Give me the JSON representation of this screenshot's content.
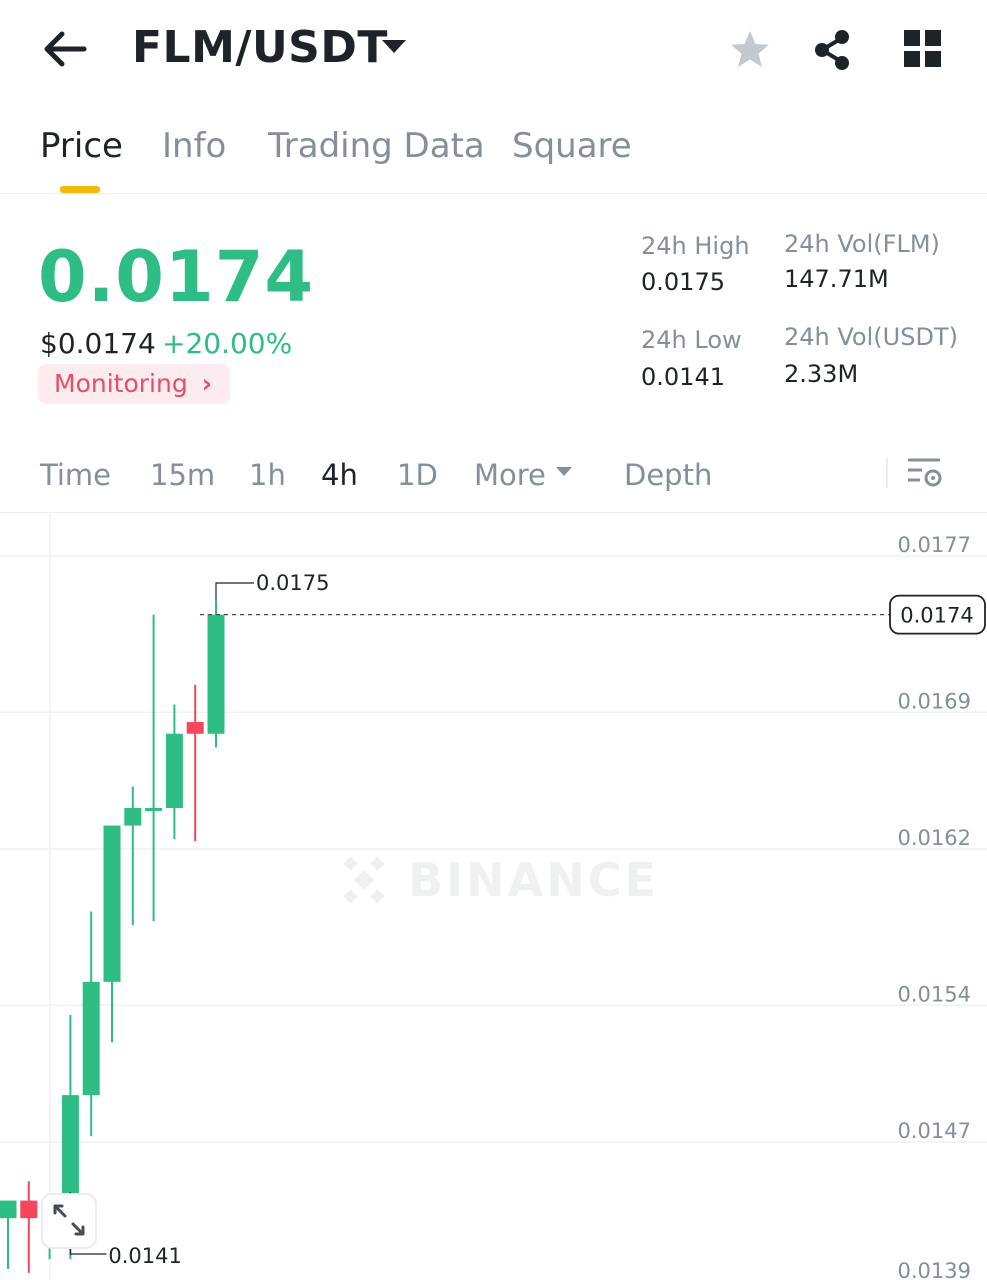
{
  "header": {
    "pair": "FLM/USDT",
    "icons": {
      "back": "back-arrow-icon",
      "caret": "caret-down-icon",
      "favorite": "star-icon",
      "share": "share-icon",
      "menu": "grid-icon"
    }
  },
  "tabs": [
    {
      "label": "Price",
      "active": true
    },
    {
      "label": "Info",
      "active": false
    },
    {
      "label": "Trading Data",
      "active": false
    },
    {
      "label": "Square",
      "active": false
    }
  ],
  "price": {
    "last": "0.0174",
    "usd": "$0.0174",
    "change": "+20.00%",
    "monitoring": "Monitoring",
    "color_up": "#2ebd85"
  },
  "stats": {
    "high_label": "24h High",
    "high": "0.0175",
    "low_label": "24h Low",
    "low": "0.0141",
    "vol_base_label": "24h Vol(FLM)",
    "vol_base": "147.71M",
    "vol_quote_label": "24h Vol(USDT)",
    "vol_quote": "2.33M"
  },
  "intervals": {
    "items": [
      "Time",
      "15m",
      "1h",
      "4h",
      "1D",
      "More",
      "Depth"
    ],
    "active": "4h"
  },
  "chart_data": {
    "type": "candlestick",
    "y_ticks": [
      "0.0177",
      "0.0169",
      "0.0162",
      "0.0154",
      "0.0147",
      "0.0139"
    ],
    "last_price_label": "0.0174",
    "high_marker": "0.0175",
    "low_marker": "0.0141",
    "watermark": "BINANCE",
    "up_color": "#2ebd85",
    "down_color": "#f6465d",
    "candles": [
      {
        "o": 0.01431,
        "h": 0.01439,
        "l": 0.01405,
        "c": 0.0144,
        "dir": "up"
      },
      {
        "o": 0.0144,
        "h": 0.0145,
        "l": 0.01403,
        "c": 0.01431,
        "dir": "down"
      },
      {
        "o": 0.01431,
        "h": 0.01435,
        "l": 0.0141,
        "c": 0.01431,
        "dir": "up"
      },
      {
        "o": 0.01431,
        "h": 0.01535,
        "l": 0.0141,
        "c": 0.01494,
        "dir": "up"
      },
      {
        "o": 0.01494,
        "h": 0.01588,
        "l": 0.01473,
        "c": 0.01552,
        "dir": "up"
      },
      {
        "o": 0.01552,
        "h": 0.01624,
        "l": 0.01521,
        "c": 0.01632,
        "dir": "up"
      },
      {
        "o": 0.01632,
        "h": 0.01652,
        "l": 0.01581,
        "c": 0.01641,
        "dir": "up"
      },
      {
        "o": 0.01641,
        "h": 0.0174,
        "l": 0.01583,
        "c": 0.01641,
        "dir": "up"
      },
      {
        "o": 0.01641,
        "h": 0.01694,
        "l": 0.01625,
        "c": 0.01679,
        "dir": "up"
      },
      {
        "o": 0.01679,
        "h": 0.01704,
        "l": 0.01624,
        "c": 0.01685,
        "dir": "down"
      },
      {
        "o": 0.01679,
        "h": 0.01748,
        "l": 0.01672,
        "c": 0.0174,
        "dir": "up"
      }
    ]
  }
}
